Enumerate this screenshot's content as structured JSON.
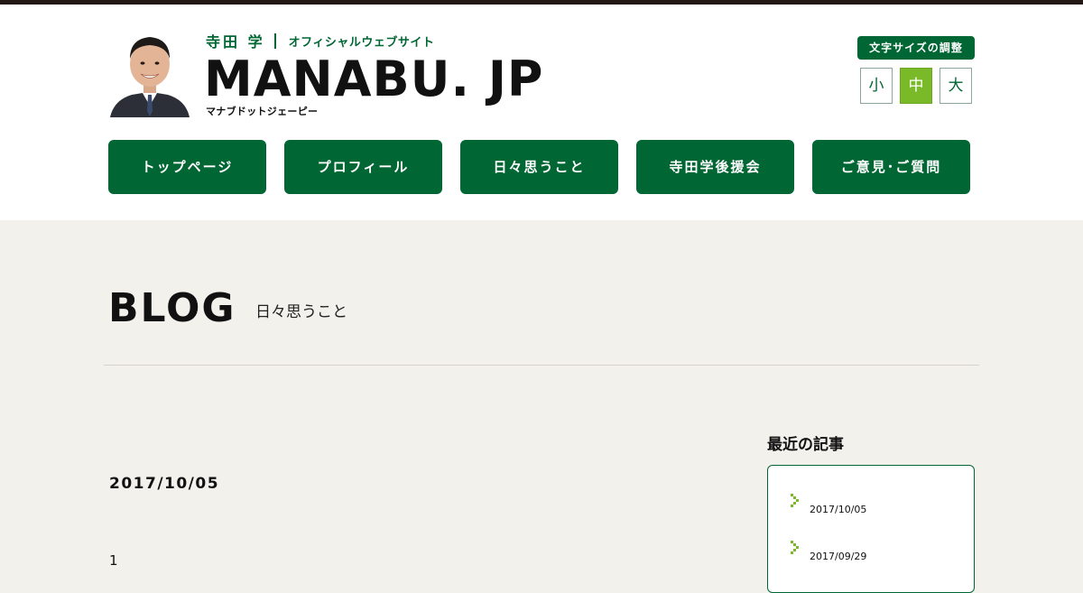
{
  "header": {
    "name": "寺田 学",
    "subtitle": "オフィシャルウェブサイト",
    "logo": "MANABU. JP",
    "logo_kana": "マナブドットジェーピー"
  },
  "font_size": {
    "label": "文字サイズの調整",
    "options": [
      "小",
      "中",
      "大"
    ],
    "selected": "中"
  },
  "nav": {
    "items": [
      "トップページ",
      "プロフィール",
      "日々思うこと",
      "寺田学後援会",
      "ご意見･ご質問"
    ]
  },
  "page": {
    "title": "BLOG",
    "subtitle": "日々思うこと"
  },
  "post": {
    "date": "2017/10/05",
    "body": "1"
  },
  "sidebar": {
    "heading": "最近の記事",
    "recent": [
      "2017/10/05",
      "2017/09/29"
    ]
  },
  "colors": {
    "brand_green": "#006633",
    "accent_green": "#7ab928",
    "topbar": "#231815",
    "page_bg": "#f2f1ec"
  },
  "icons": {
    "recent_bullet": "chevron-right-icon"
  }
}
